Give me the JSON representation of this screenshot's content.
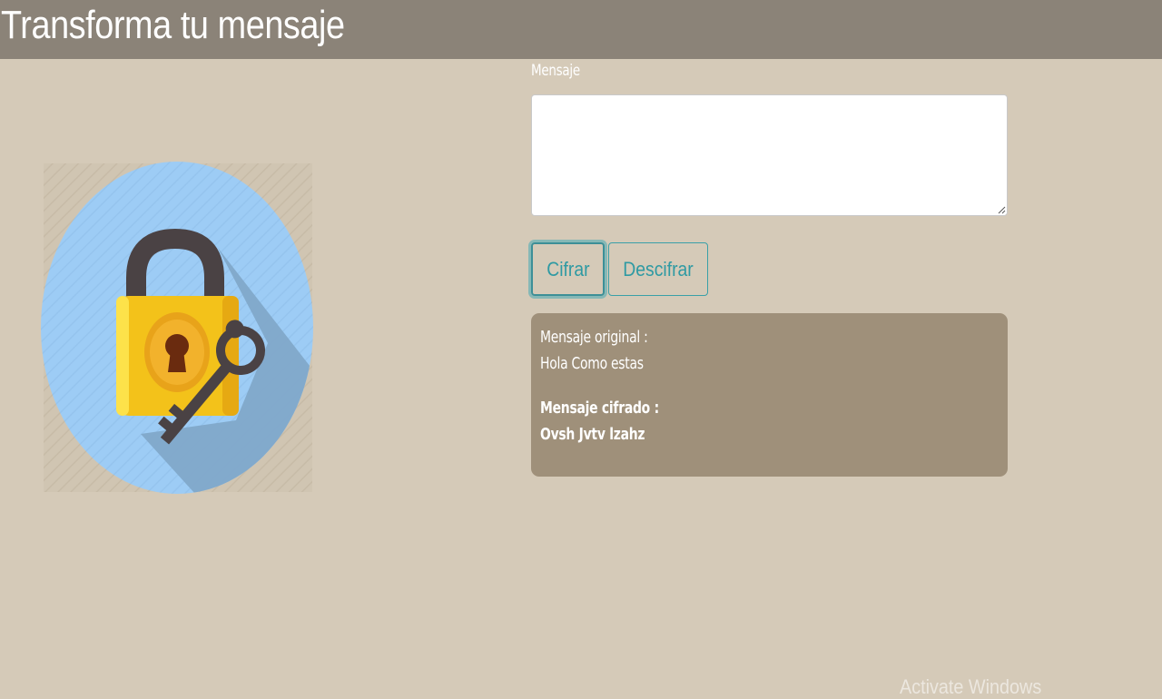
{
  "header": {
    "title": "Transforma tu mensaje"
  },
  "illustration": {
    "icon": "padlock-and-key-icon"
  },
  "form": {
    "label": "Mensaje",
    "message_value": "",
    "encrypt_label": "Cifrar",
    "decrypt_label": "Descifrar"
  },
  "result": {
    "original_label": "Mensaje original :",
    "original_value": "Hola Como estas",
    "encrypted_label": "Mensaje cifrado :",
    "encrypted_value": "Ovsh Jvtv lzahz"
  },
  "os_watermark": "Activate Windows",
  "colors": {
    "header_bg": "#8b8378",
    "page_bg": "#d5cab8",
    "accent": "#2f9aa3",
    "result_bg": "#9f907a"
  }
}
